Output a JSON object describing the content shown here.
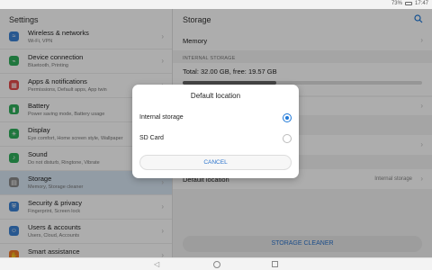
{
  "status": {
    "time": "17:47",
    "battery": "73%"
  },
  "left": {
    "title": "Settings",
    "items": [
      {
        "title": "Wireless & networks",
        "sub": "Wi-Fi, VPN",
        "icon": "wifi-icon",
        "color": "#3b82d4",
        "glyph": "≈",
        "selected": false
      },
      {
        "title": "Device connection",
        "sub": "Bluetooth, Printing",
        "icon": "device-connection-icon",
        "color": "#2fae5a",
        "glyph": "⌁",
        "selected": false
      },
      {
        "title": "Apps & notifications",
        "sub": "Permissions, Default apps, App twin",
        "icon": "apps-icon",
        "color": "#e34b4b",
        "glyph": "▦",
        "selected": false
      },
      {
        "title": "Battery",
        "sub": "Power saving mode, Battery usage",
        "icon": "battery-icon",
        "color": "#2fae5a",
        "glyph": "▮",
        "selected": false
      },
      {
        "title": "Display",
        "sub": "Eye comfort, Home screen style, Wallpaper",
        "icon": "display-icon",
        "color": "#2fae5a",
        "glyph": "☀",
        "selected": false
      },
      {
        "title": "Sound",
        "sub": "Do not disturb, Ringtone, Vibrate",
        "icon": "sound-icon",
        "color": "#2fae5a",
        "glyph": "♪",
        "selected": false
      },
      {
        "title": "Storage",
        "sub": "Memory, Storage cleaner",
        "icon": "storage-icon",
        "color": "#8a8a8a",
        "glyph": "▤",
        "selected": true
      },
      {
        "title": "Security & privacy",
        "sub": "Fingerprint, Screen lock",
        "icon": "security-icon",
        "color": "#3b82d4",
        "glyph": "⛨",
        "selected": false
      },
      {
        "title": "Users & accounts",
        "sub": "Users, Cloud, Accounts",
        "icon": "users-icon",
        "color": "#3b82d4",
        "glyph": "☺",
        "selected": false
      },
      {
        "title": "Smart assistance",
        "sub": "",
        "icon": "smart-assistance-icon",
        "color": "#f07a2a",
        "glyph": "✋",
        "selected": false
      }
    ]
  },
  "right": {
    "title": "Storage",
    "memory": "Memory",
    "section": "INTERNAL STORAGE",
    "total": "Total: 32.00 GB, free: 19.57 GB",
    "used_fraction": 0.39,
    "default_location_label": "Default location",
    "default_location_value": "Internal storage",
    "cleaner": "STORAGE CLEANER"
  },
  "dialog": {
    "title": "Default location",
    "options": [
      {
        "label": "Internal storage",
        "selected": true
      },
      {
        "label": "SD Card",
        "selected": false
      }
    ],
    "cancel": "CANCEL"
  }
}
